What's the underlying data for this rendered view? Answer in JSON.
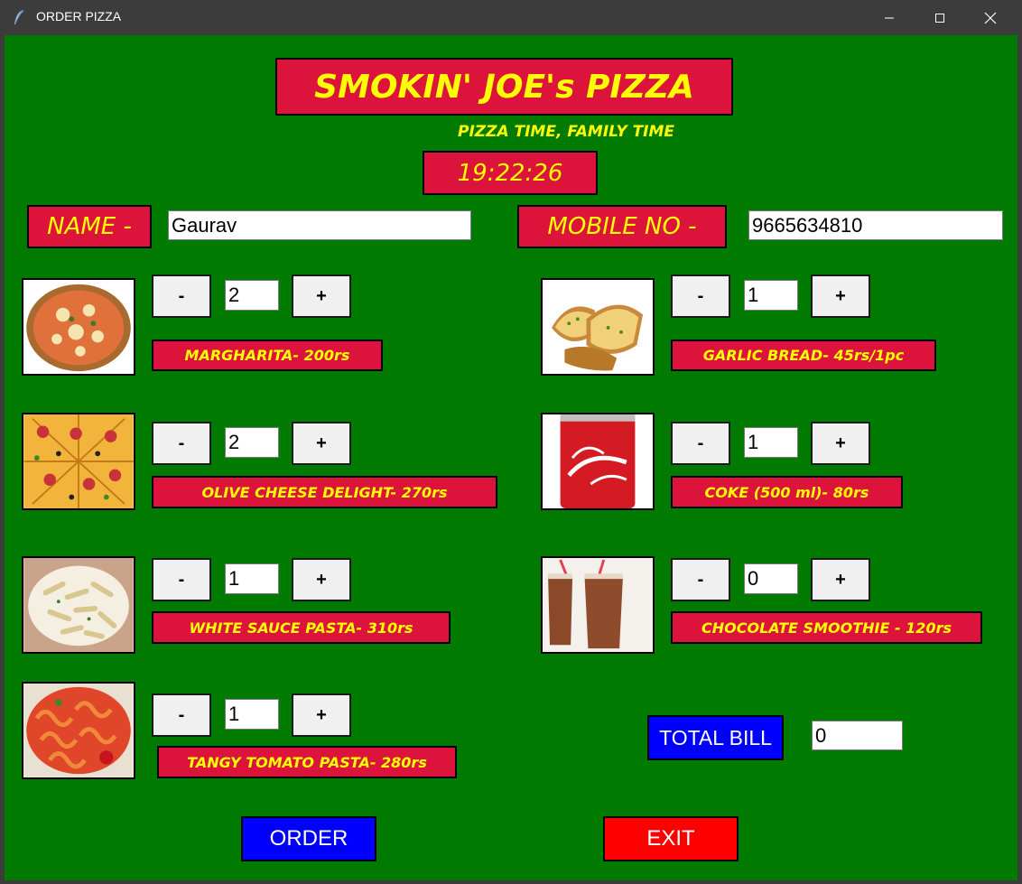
{
  "window": {
    "title": "ORDER PIZZA",
    "icon": "feather-icon"
  },
  "header": {
    "brand": "SMOKIN' JOE's PIZZA",
    "tagline": "PIZZA TIME, FAMILY TIME",
    "clock": "19:22:26"
  },
  "customer": {
    "name_label": "NAME -",
    "name_value": "Gaurav",
    "mobile_label": "MOBILE NO -",
    "mobile_value": "9665634810"
  },
  "buttons": {
    "minus": "-",
    "plus": "+"
  },
  "menu_left": [
    {
      "label": "MARGHARITA- 200rs",
      "qty": "2",
      "image": "margherita-pizza-image"
    },
    {
      "label": "OLIVE CHEESE DELIGHT- 270rs",
      "qty": "2",
      "image": "olive-cheese-pizza-image"
    },
    {
      "label": "WHITE SAUCE PASTA- 310rs",
      "qty": "1",
      "image": "white-sauce-pasta-image"
    },
    {
      "label": "TANGY TOMATO PASTA- 280rs",
      "qty": "1",
      "image": "tomato-pasta-image"
    }
  ],
  "menu_right": [
    {
      "label": "GARLIC BREAD- 45rs/1pc",
      "qty": "1",
      "image": "garlic-bread-image"
    },
    {
      "label": "COKE (500 ml)- 80rs",
      "qty": "1",
      "image": "coke-can-image"
    },
    {
      "label": "CHOCOLATE SMOOTHIE - 120rs",
      "qty": "0",
      "image": "chocolate-smoothie-image"
    }
  ],
  "bill": {
    "label": "TOTAL BILL",
    "value": "0"
  },
  "actions": {
    "order": "ORDER",
    "exit": "EXIT"
  },
  "colors": {
    "background": "#007a00",
    "label_bg": "#dc143c",
    "label_text": "#ffff00",
    "order": "#0000ff",
    "exit": "#ff0000"
  }
}
